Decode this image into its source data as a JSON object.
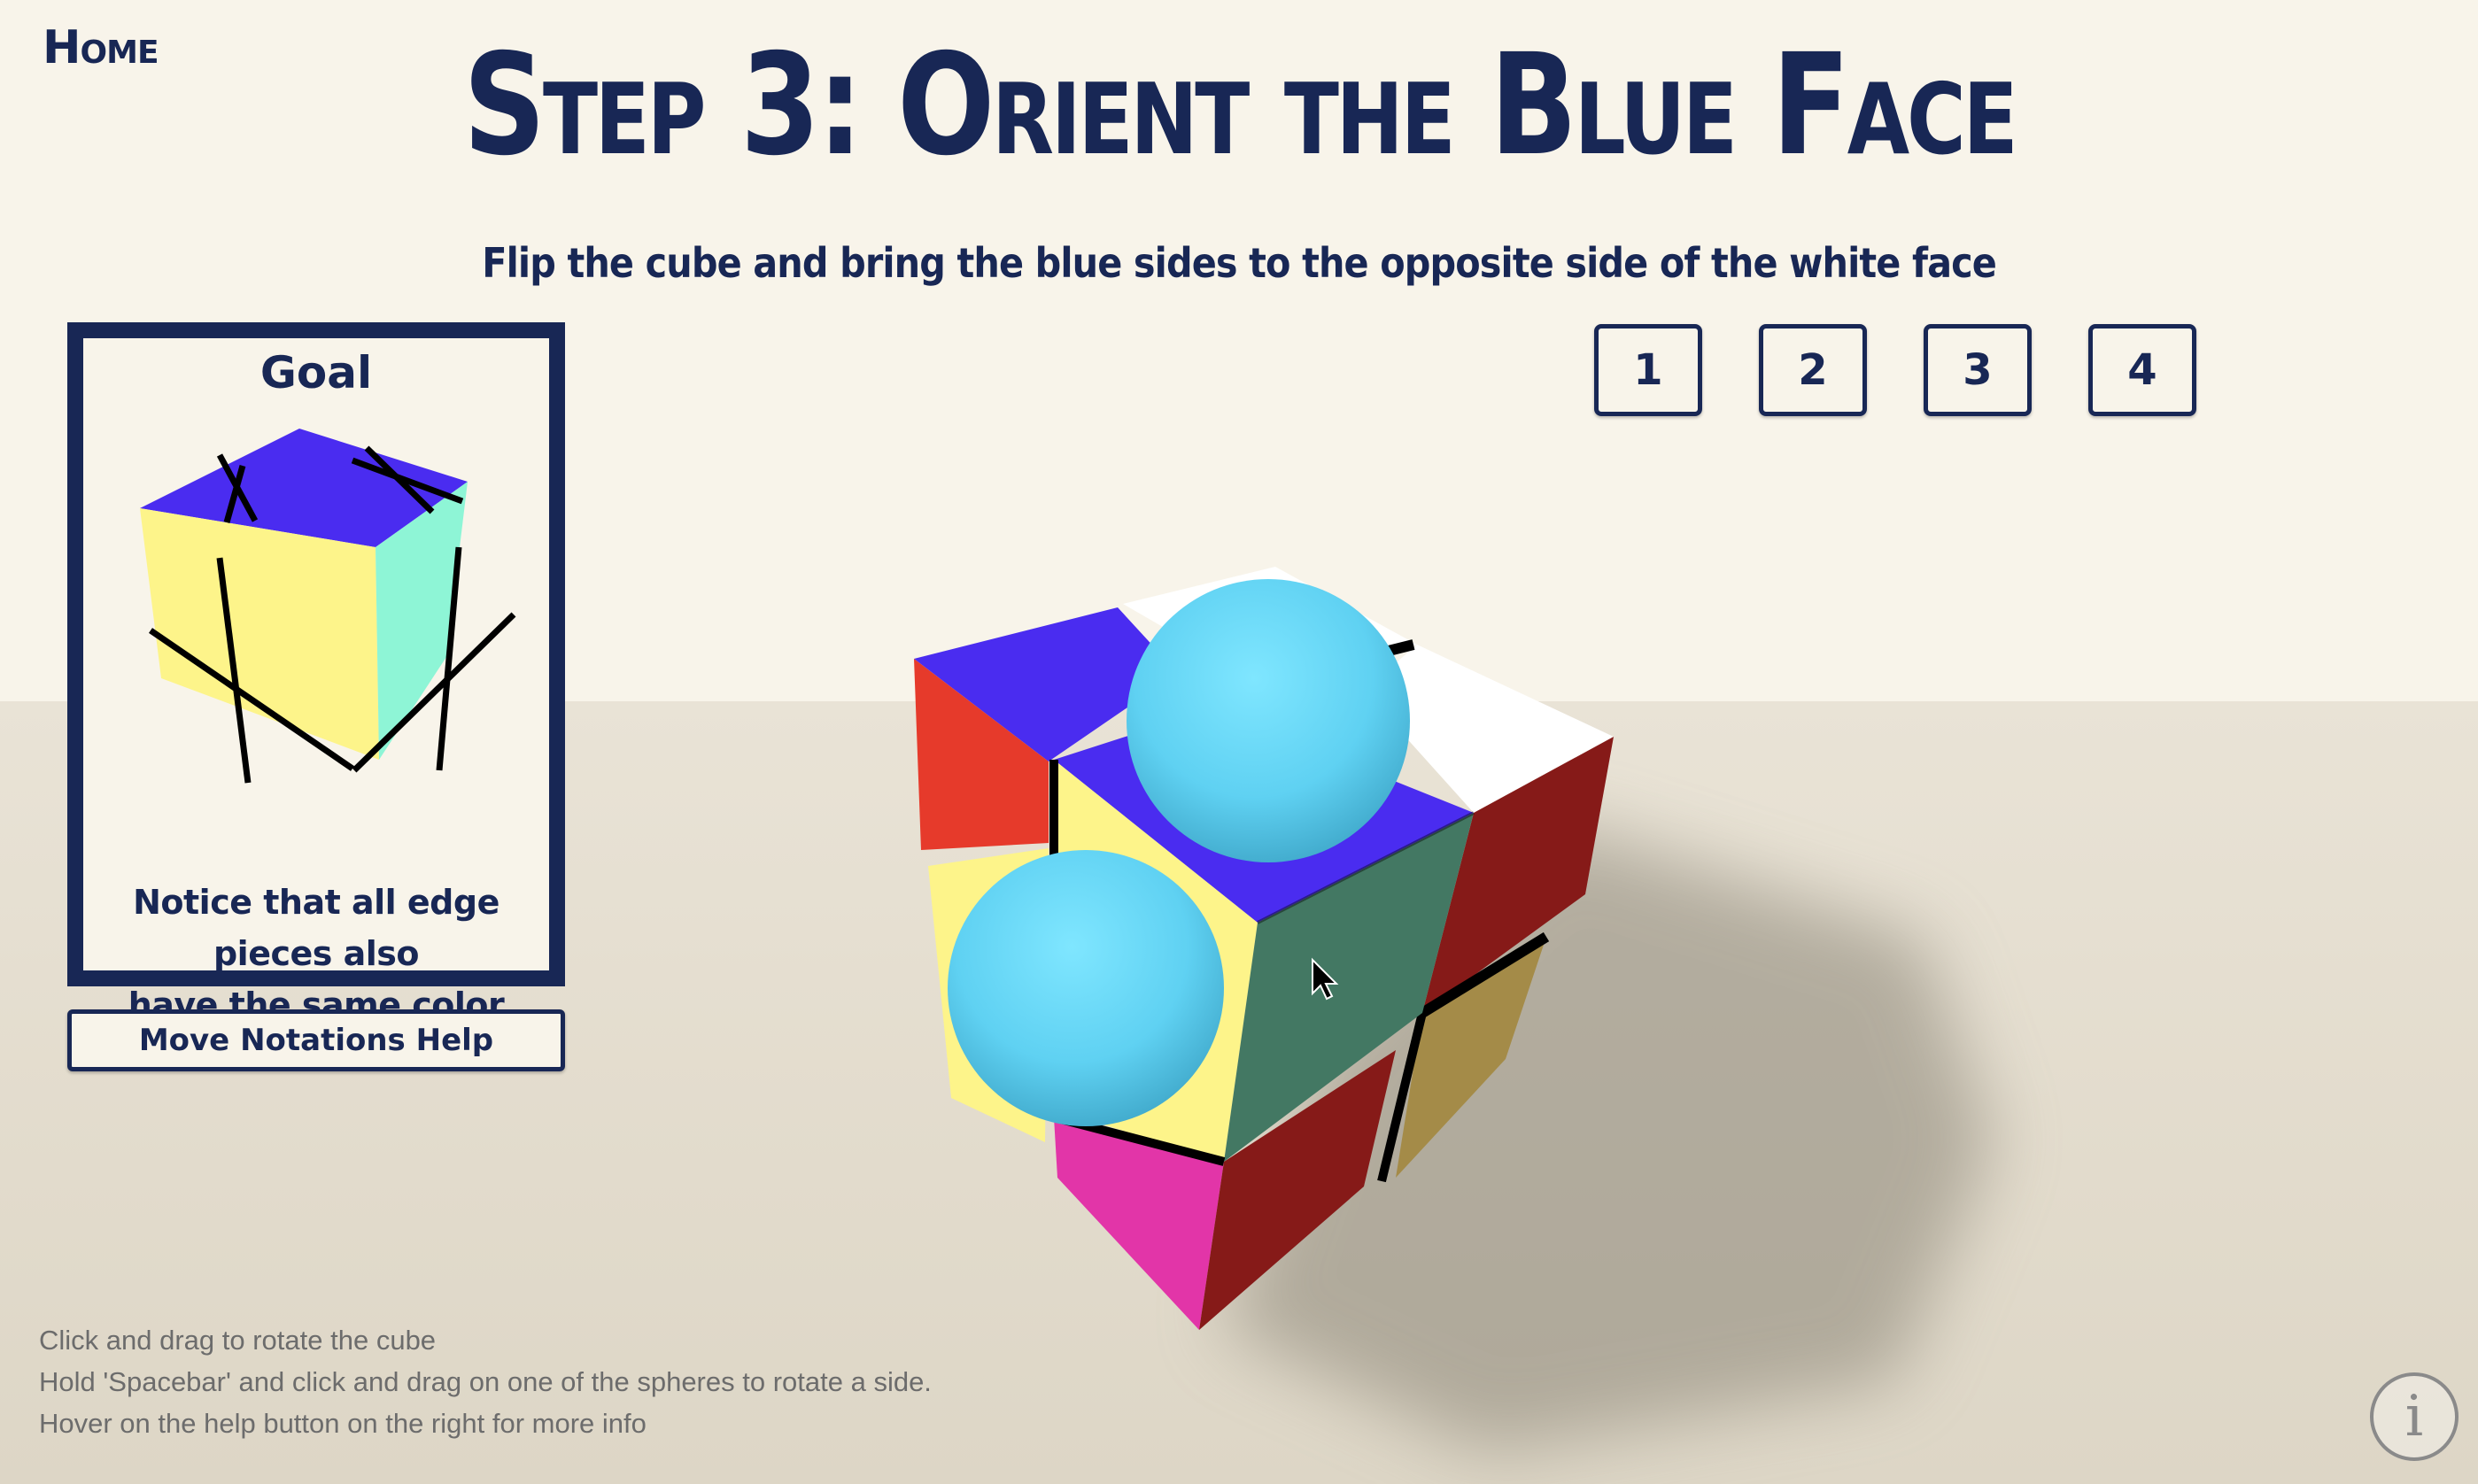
{
  "nav": {
    "home_label": "Home"
  },
  "header": {
    "title": "Step 3: Orient the Blue Face",
    "subtitle": "Flip the cube and bring the blue sides to the opposite side of the white face"
  },
  "steps": [
    {
      "label": "1"
    },
    {
      "label": "2"
    },
    {
      "label": "3"
    },
    {
      "label": "4"
    }
  ],
  "goal": {
    "title": "Goal",
    "note_line1": "Notice that all edge pieces also",
    "note_line2": "have the same color"
  },
  "notation_button": {
    "label": "Move Notations Help"
  },
  "instructions": {
    "line1": "Click and drag to rotate the cube",
    "line2": "Hold 'Spacebar' and click and drag on one of the spheres to rotate a side.",
    "line3": "Hover on the help button on the right for more info"
  },
  "info_button": {
    "icon": "info-icon",
    "glyph": "i"
  },
  "colors": {
    "navy": "#182755",
    "blue_face": "#4a2cf0",
    "yellow": "#fdf48a",
    "mint": "#8ef5d6",
    "red": "#e63a2b",
    "dark_red": "#861a18",
    "white": "#ffffff",
    "green": "#437863",
    "magenta": "#e235a8",
    "olive": "#a48b48",
    "sphere": "#5fd1f2"
  }
}
